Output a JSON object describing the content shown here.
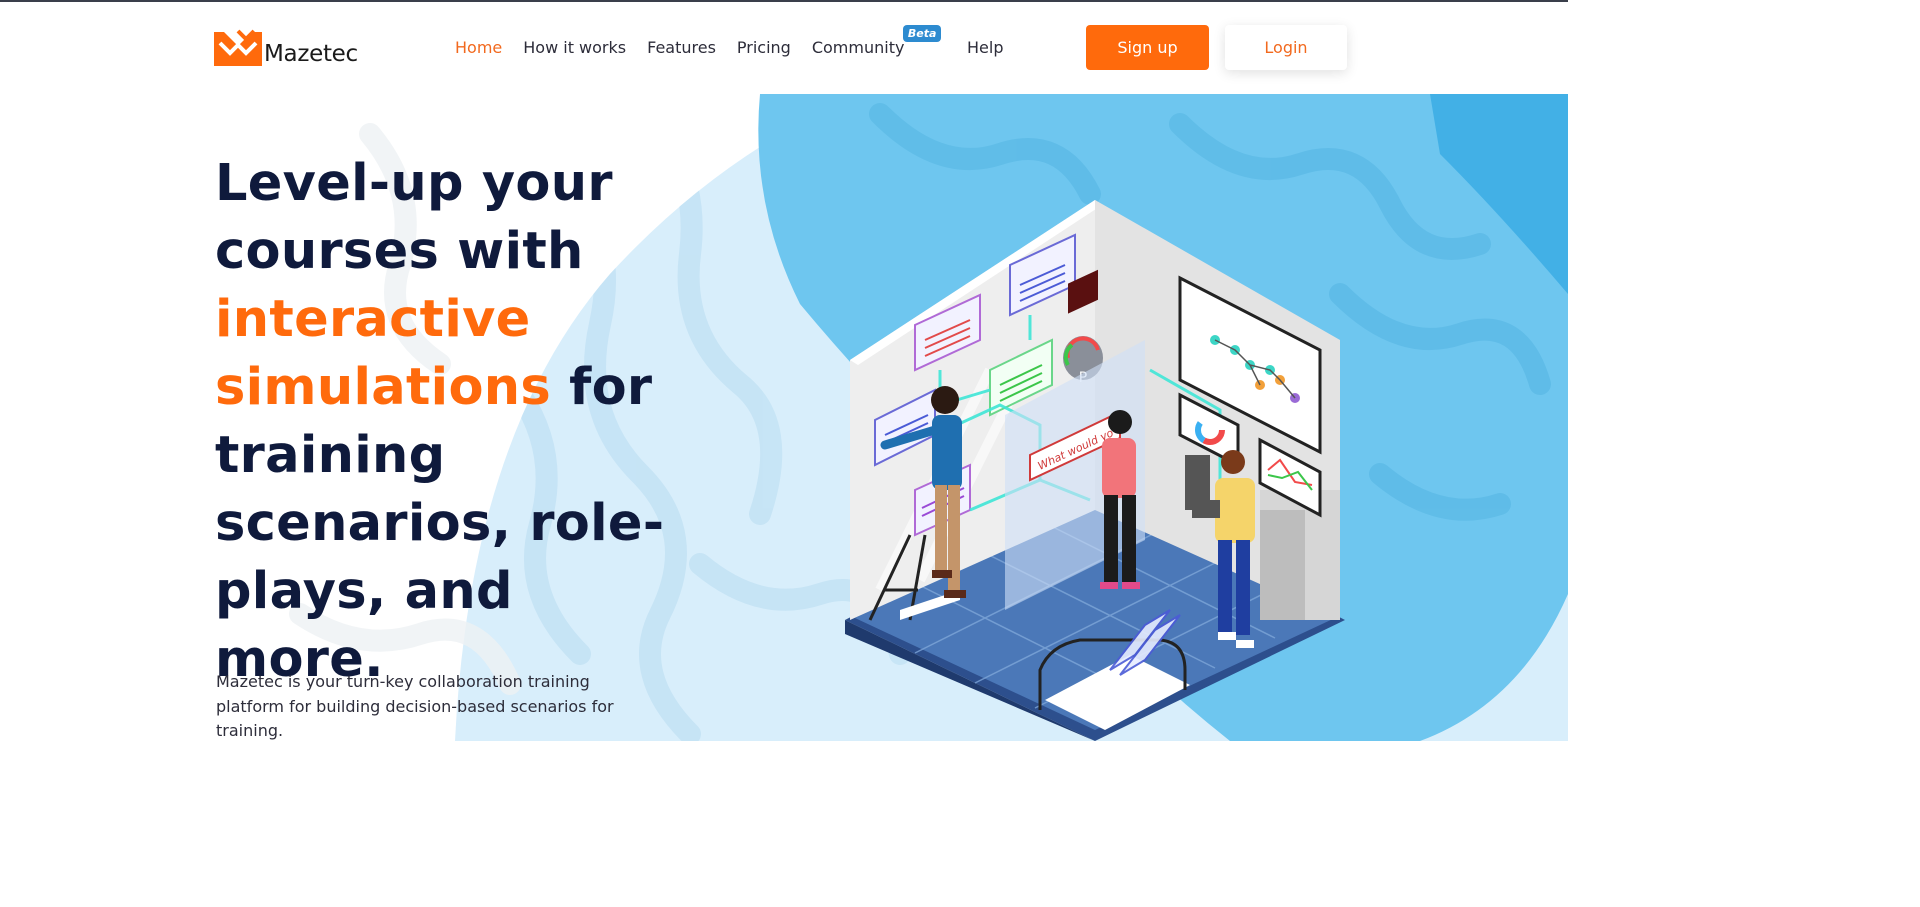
{
  "brand": {
    "name": "Mazetec",
    "color": "#ff6a0c",
    "logo_icon": "mazetec-logo-icon"
  },
  "nav": {
    "items": [
      {
        "label": "Home",
        "active": true
      },
      {
        "label": "How it works"
      },
      {
        "label": "Features"
      },
      {
        "label": "Pricing"
      },
      {
        "label": "Community",
        "badge": "Beta"
      }
    ],
    "help": "Help"
  },
  "actions": {
    "signup": "Sign up",
    "login": "Login"
  },
  "hero": {
    "headline_part1": "Level-up your courses with ",
    "headline_accent": "interactive simulations",
    "headline_part2": " for training scenarios, role-plays, and more.",
    "description": "Mazetec is your turn-key collaboration training platform for building decision-based scenarios for training.",
    "illustration_bubble": "What would yo",
    "illustration_gauge_letter": "P"
  },
  "colors": {
    "accent": "#ff6a0c",
    "navy": "#0f1a3c",
    "sky": "#6ec6ef",
    "sky_light": "#d8eefb",
    "beta_badge": "#2d8bd0"
  }
}
